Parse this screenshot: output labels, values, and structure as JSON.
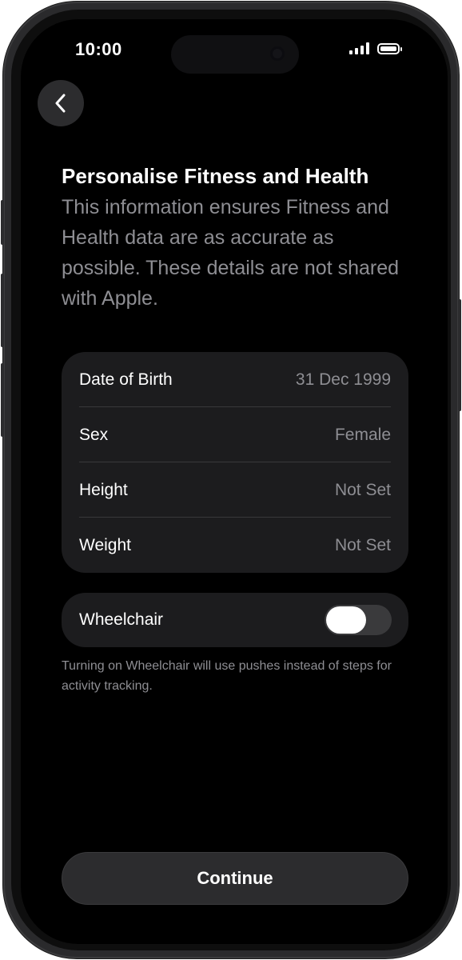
{
  "status_bar": {
    "time": "10:00",
    "signal_icon": "cellular-signal-icon",
    "battery_icon": "battery-icon"
  },
  "nav": {
    "back_icon": "chevron-left-icon"
  },
  "header": {
    "title": "Personalise Fitness and Health",
    "description": "This information ensures Fitness and Health data are as accurate as possible. These details are not shared with Apple."
  },
  "details": [
    {
      "label": "Date of Birth",
      "value": "31 Dec 1999"
    },
    {
      "label": "Sex",
      "value": "Female"
    },
    {
      "label": "Height",
      "value": "Not Set"
    },
    {
      "label": "Weight",
      "value": "Not Set"
    }
  ],
  "wheelchair": {
    "label": "Wheelchair",
    "enabled": false,
    "footnote": "Turning on Wheelchair will use pushes instead of steps for activity tracking."
  },
  "footer": {
    "continue_label": "Continue"
  },
  "colors": {
    "background": "#000000",
    "card": "#1c1c1e",
    "secondary_text": "#8e8e93",
    "toggle_track_off": "#3a3a3c"
  }
}
